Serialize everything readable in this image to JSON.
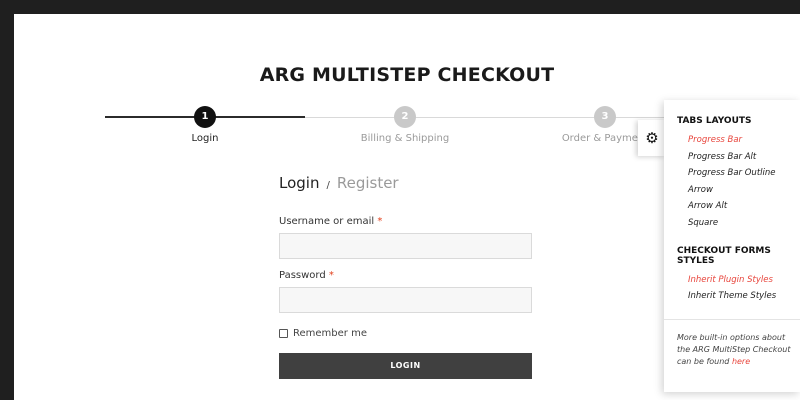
{
  "page": {
    "title": "ARG MULTISTEP CHECKOUT"
  },
  "steps": [
    {
      "number": "1",
      "label": "Login",
      "active": true
    },
    {
      "number": "2",
      "label": "Billing & Shipping",
      "active": false
    },
    {
      "number": "3",
      "label": "Order & Payment",
      "active": false
    }
  ],
  "form": {
    "tabs": {
      "login": "Login",
      "separator": "/",
      "register": "Register"
    },
    "username_label": "Username or email",
    "username_value": "",
    "password_label": "Password",
    "password_value": "",
    "required_mark": "*",
    "remember_label": "Remember me",
    "remember_checked": false,
    "login_button": "LOGIN"
  },
  "settings_panel": {
    "gear_icon": "gear-icon",
    "tabs_layouts_heading": "TABS LAYOUTS",
    "tabs_layouts": [
      {
        "label": "Progress Bar",
        "selected": true
      },
      {
        "label": "Progress Bar Alt",
        "selected": false
      },
      {
        "label": "Progress Bar Outline",
        "selected": false
      },
      {
        "label": "Arrow",
        "selected": false
      },
      {
        "label": "Arrow Alt",
        "selected": false
      },
      {
        "label": "Square",
        "selected": false
      }
    ],
    "forms_styles_heading": "CHECKOUT FORMS STYLES",
    "forms_styles": [
      {
        "label": "Inherit Plugin Styles",
        "selected": true
      },
      {
        "label": "Inherit Theme Styles",
        "selected": false
      }
    ],
    "note_text": "More built-in options about the ARG MultiStep Checkout can be found ",
    "note_link": "here"
  },
  "colors": {
    "accent": "#e8453c",
    "active_step": "#111111",
    "inactive_step": "#c9c9c9",
    "button": "#404040",
    "background_frame": "#1f1f1f"
  }
}
